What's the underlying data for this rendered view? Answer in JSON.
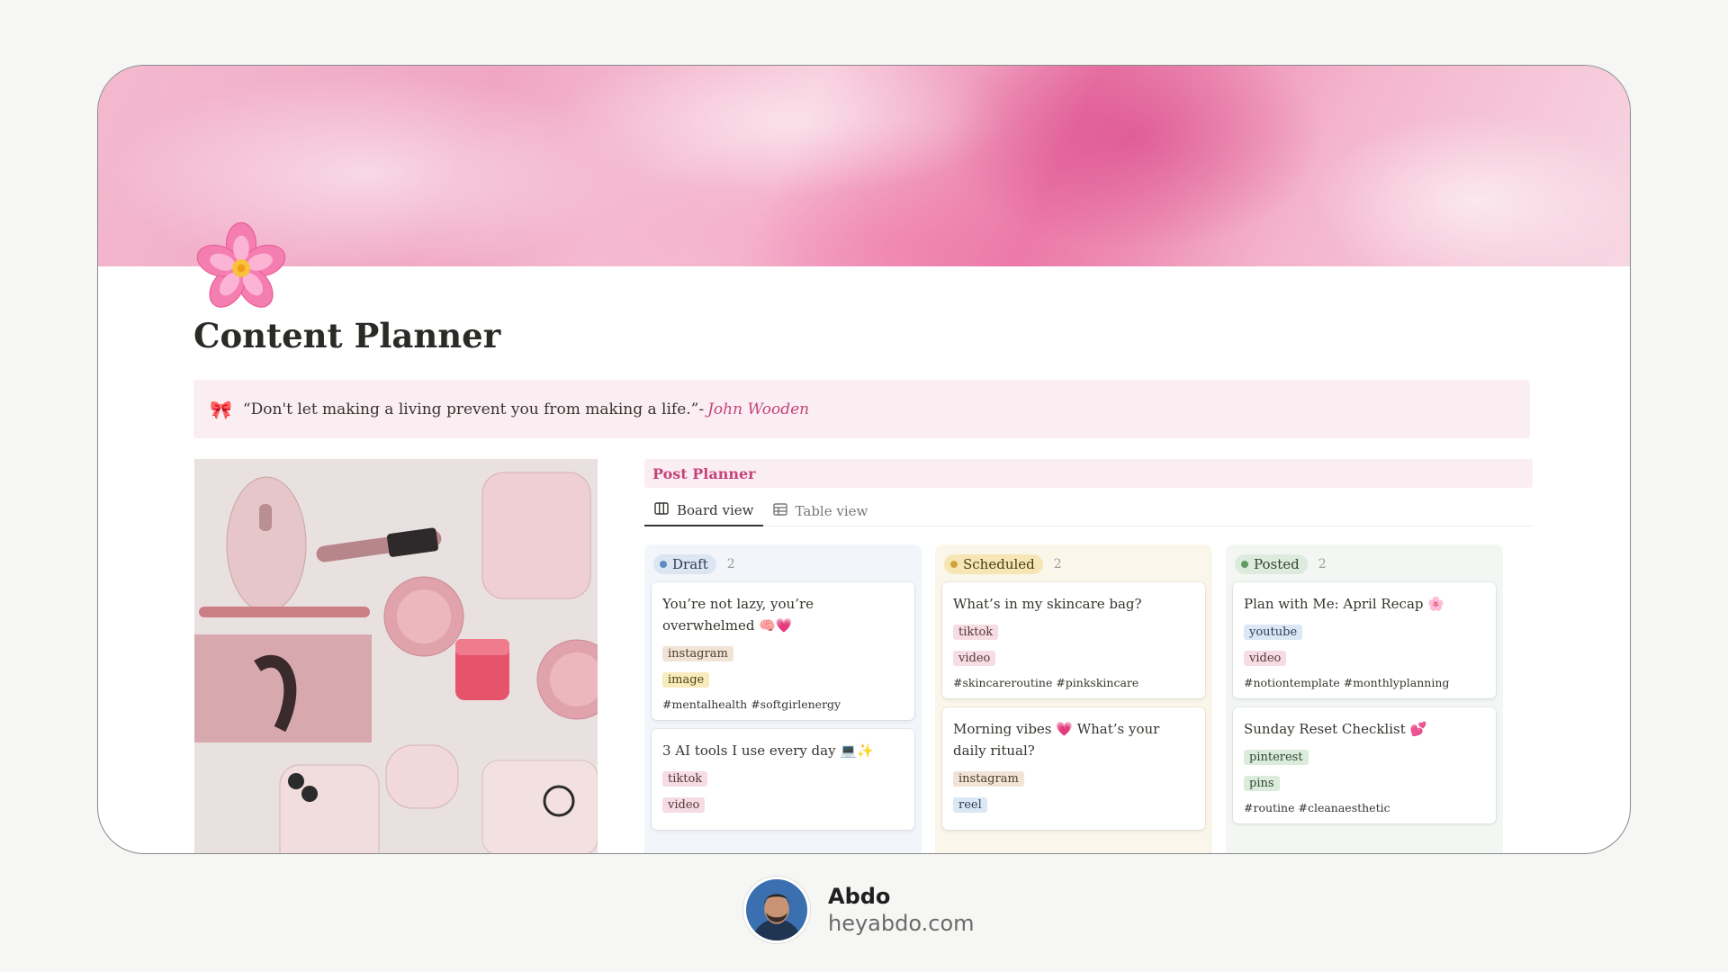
{
  "page": {
    "title": "Content Planner",
    "icon": "cherry-blossom-icon"
  },
  "callout": {
    "icon": "ribbon-icon",
    "quote": "“Don't let making a living prevent you from making a life.”-",
    "author": "John Wooden"
  },
  "planner": {
    "heading": "Post Planner",
    "tabs": [
      {
        "label": "Board view",
        "icon": "board-icon",
        "active": true
      },
      {
        "label": "Table view",
        "icon": "table-icon",
        "active": false
      }
    ],
    "columns": [
      {
        "name": "Draft",
        "count": "2",
        "color": "#5b8cc4",
        "cards": [
          {
            "title": "You’re not lazy, you’re overwhelmed 🧠💗",
            "tags": [
              "instagram",
              "image"
            ],
            "hashtags": "#mentalhealth #softgirlenergy"
          },
          {
            "title": "3 AI tools I use every day 💻✨",
            "tags": [
              "tiktok",
              "video"
            ],
            "hashtags": ""
          }
        ]
      },
      {
        "name": "Scheduled",
        "count": "2",
        "color": "#d4a23c",
        "cards": [
          {
            "title": "What’s in my skincare bag?",
            "tags": [
              "tiktok",
              "video"
            ],
            "hashtags": "#skincareroutine #pinkskincare"
          },
          {
            "title": "Morning vibes 💗 What’s your daily ritual?",
            "tags": [
              "instagram",
              "reel"
            ],
            "hashtags": ""
          }
        ]
      },
      {
        "name": "Posted",
        "count": "2",
        "color": "#5f9a65",
        "cards": [
          {
            "title": "Plan with Me: April Recap 🌸",
            "tags": [
              "youtube",
              "video"
            ],
            "hashtags": "#notiontemplate #monthlyplanning"
          },
          {
            "title": "Sunday Reset Checklist 💕",
            "tags": [
              "pinterest",
              "pins"
            ],
            "hashtags": "#routine #cleanaesthetic"
          }
        ]
      }
    ]
  },
  "footer": {
    "name": "Abdo",
    "site": "heyabdo.com"
  },
  "colors": {
    "accent": "#c4447a",
    "callout_bg": "#fbeef3",
    "page_bg": "#f6f6f4"
  }
}
